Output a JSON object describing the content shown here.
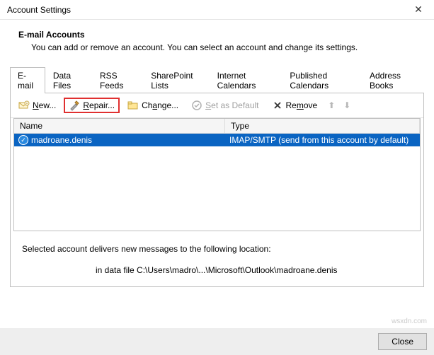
{
  "window": {
    "title": "Account Settings"
  },
  "header": {
    "title": "E-mail Accounts",
    "subtitle": "You can add or remove an account. You can select an account and change its settings."
  },
  "tabs": {
    "items": [
      {
        "label": "E-mail",
        "active": true
      },
      {
        "label": "Data Files",
        "active": false
      },
      {
        "label": "RSS Feeds",
        "active": false
      },
      {
        "label": "SharePoint Lists",
        "active": false
      },
      {
        "label": "Internet Calendars",
        "active": false
      },
      {
        "label": "Published Calendars",
        "active": false
      },
      {
        "label": "Address Books",
        "active": false
      }
    ]
  },
  "toolbar": {
    "new_prefix": "N",
    "new_rest": "ew...",
    "repair_prefix": "R",
    "repair_rest": "epair...",
    "change_prefix": "Ch",
    "change_mid": "a",
    "change_rest": "nge...",
    "default_prefix": "S",
    "default_rest": "et as Default",
    "remove_prefix": "Re",
    "remove_mid": "m",
    "remove_rest": "ove"
  },
  "grid": {
    "columns": {
      "name": "Name",
      "type": "Type"
    },
    "rows": [
      {
        "name": "madroane.denis",
        "type": "IMAP/SMTP (send from this account by default)"
      }
    ]
  },
  "info": {
    "delivers": "Selected account delivers new messages to the following location:",
    "path": "in data file C:\\Users\\madro\\...\\Microsoft\\Outlook\\madroane.denis"
  },
  "footer": {
    "close_prefix": "C",
    "close_mid": "l",
    "close_rest": "ose"
  },
  "watermark": "wsxdn.com"
}
